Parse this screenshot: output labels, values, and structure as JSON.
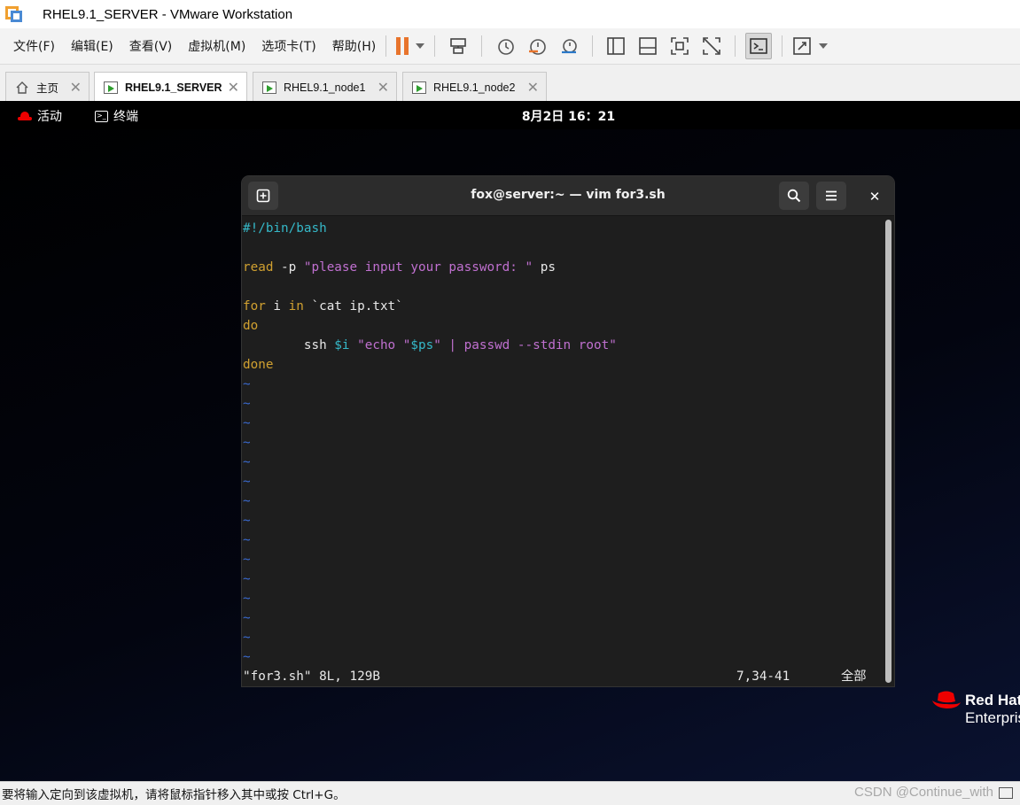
{
  "window": {
    "title": "RHEL9.1_SERVER - VMware Workstation"
  },
  "menu": {
    "items": [
      "文件(F)",
      "编辑(E)",
      "查看(V)",
      "虚拟机(M)",
      "选项卡(T)",
      "帮助(H)"
    ]
  },
  "toolbar": {
    "icons": [
      "pause-icon",
      "send-ctrl-alt-del-icon",
      "snapshot-icon",
      "revert-snapshot-icon",
      "snapshot-manager-icon",
      "library-icon",
      "thumbnail-bar-icon",
      "full-screen-icon",
      "unity-icon",
      "console-view-icon",
      "stretch-icon"
    ],
    "accent": "#e8742c"
  },
  "tabs": [
    {
      "label": "主页",
      "icon": "home-icon"
    },
    {
      "label": "RHEL9.1_SERVER",
      "icon": "vm-icon",
      "active": true
    },
    {
      "label": "RHEL9.1_node1",
      "icon": "vm-icon"
    },
    {
      "label": "RHEL9.1_node2",
      "icon": "vm-icon"
    }
  ],
  "gnome": {
    "activities": "活动",
    "app": "终端",
    "clock": "8月2日 16：21"
  },
  "terminal": {
    "title": "fox@server:~ — vim for3.sh",
    "lines": {
      "shebang": "#!/bin/bash",
      "read_kw": "read",
      "read_opt": " -p ",
      "read_prompt": "\"please input your password: \"",
      "read_var": " ps",
      "for_kw": "for",
      "for_i": " i ",
      "in_kw": "in",
      "for_cmd": " `cat ip.txt`",
      "do_kw": "do",
      "ssh_cmd": "        ssh ",
      "ssh_var": "$i",
      "ssh_sp": " ",
      "ssh_str1": "\"echo \"",
      "ssh_ps": "$ps",
      "ssh_str2": "\" | passwd --stdin root\"",
      "done_kw": "done"
    },
    "tilde": "~",
    "status_file": "\"for3.sh\" 8L, 129B",
    "status_pos": "7,34-41",
    "status_all": "全部"
  },
  "brand": {
    "line1": "Red Hat",
    "line2": "Enterprise"
  },
  "statusbar": {
    "message": "要将输入定向到该虚拟机，请将鼠标指针移入其中或按 Ctrl+G。",
    "watermark": "CSDN @Continue_with"
  }
}
